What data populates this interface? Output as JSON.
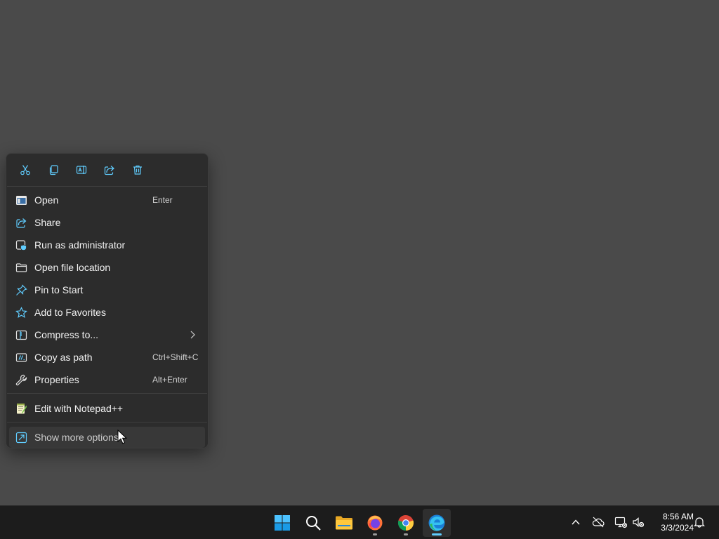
{
  "context_menu": {
    "toolbar": [
      {
        "icon": "cut-icon",
        "label": "Cut"
      },
      {
        "icon": "copy-icon",
        "label": "Copy"
      },
      {
        "icon": "rename-icon",
        "label": "Rename"
      },
      {
        "icon": "share-icon",
        "label": "Share"
      },
      {
        "icon": "delete-icon",
        "label": "Delete"
      }
    ],
    "items": [
      {
        "label": "Open",
        "shortcut": "Enter",
        "icon": "open-window-icon"
      },
      {
        "label": "Share",
        "shortcut": "",
        "icon": "share-icon"
      },
      {
        "label": "Run as administrator",
        "shortcut": "",
        "icon": "admin-shield-icon"
      },
      {
        "label": "Open file location",
        "shortcut": "",
        "icon": "folder-icon"
      },
      {
        "label": "Pin to Start",
        "shortcut": "",
        "icon": "pin-icon"
      },
      {
        "label": "Add to Favorites",
        "shortcut": "",
        "icon": "star-icon"
      },
      {
        "label": "Compress to...",
        "shortcut": "",
        "icon": "zip-icon",
        "submenu": true
      },
      {
        "label": "Copy as path",
        "shortcut": "Ctrl+Shift+C",
        "icon": "copy-path-icon"
      },
      {
        "label": "Properties",
        "shortcut": "Alt+Enter",
        "icon": "wrench-icon"
      }
    ],
    "extra_item": {
      "label": "Edit with Notepad++",
      "icon": "notepad-plus-plus-icon"
    },
    "more_options": {
      "label": "Show more options",
      "icon": "more-options-icon"
    }
  },
  "taskbar": {
    "apps": [
      {
        "name": "Start",
        "icon": "windows-start-icon"
      },
      {
        "name": "Search",
        "icon": "search-icon"
      },
      {
        "name": "File Explorer",
        "icon": "file-explorer-icon"
      },
      {
        "name": "Firefox",
        "icon": "firefox-icon"
      },
      {
        "name": "Chrome",
        "icon": "chrome-icon"
      },
      {
        "name": "Edge",
        "icon": "edge-icon",
        "active": true
      }
    ],
    "tray": {
      "time": "8:56 AM",
      "date": "3/3/2024"
    }
  },
  "colors": {
    "desktop": "#4a4a4a",
    "menu_bg": "#2c2c2c",
    "accent": "#60cdff",
    "taskbar": "#1c1c1c"
  }
}
